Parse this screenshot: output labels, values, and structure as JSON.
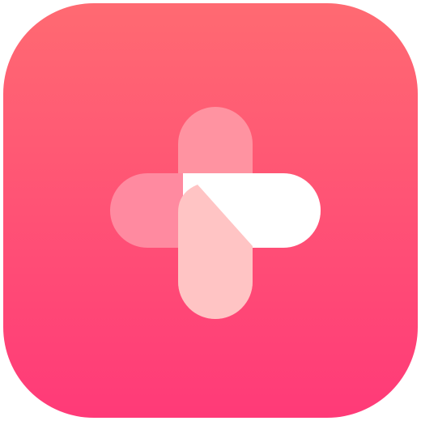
{
  "app_icon": {
    "icon": "medical-cross-icon",
    "colors": {
      "background_top": "#ff6a72",
      "background_bottom": "#ff3a78",
      "vertical_bar_top": "#ff93a1",
      "horizontal_bar_left": "#ff8aa0",
      "overlap_lower": "#ffc4c4",
      "overlap_upper": "#ffffff"
    }
  }
}
